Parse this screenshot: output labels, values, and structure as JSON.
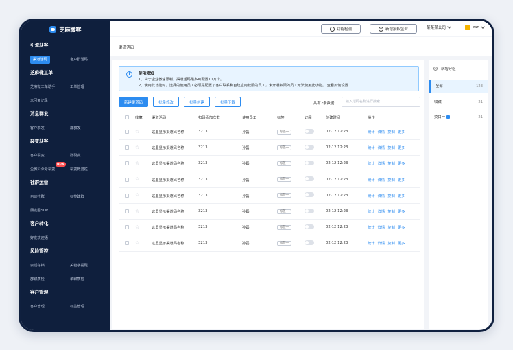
{
  "app": {
    "name": "芝麻微客"
  },
  "sidebar": {
    "sections": [
      {
        "title": "引流获客",
        "items": [
          "渠道活码",
          "客户群活码"
        ]
      },
      {
        "title": "芝麻微工单",
        "items": [
          "芝麻微工单助手",
          "工单管理",
          "未回复记录"
        ]
      },
      {
        "title": "消息群发",
        "items": [
          "客户群发",
          "群群发"
        ]
      },
      {
        "title": "裂变获客",
        "items": [
          "客户裂变",
          "群裂变",
          "企微公众号裂变",
          "裂变概览栏"
        ]
      },
      {
        "title": "社群运营",
        "items": [
          "自动拉群",
          "标签建群",
          "朋友圈SOP"
        ]
      },
      {
        "title": "客户转化",
        "items": [
          "好友欢迎语"
        ]
      },
      {
        "title": "风险管控",
        "items": [
          "会话存档",
          "关键字提醒",
          "群聊质检",
          "单聊质检"
        ]
      },
      {
        "title": "客户管理",
        "items": [
          "客户管理",
          "标签管理"
        ]
      }
    ],
    "new_badge": "NEW"
  },
  "topbar": {
    "btn_check": "功能检测",
    "btn_add_company": "新增授权企业",
    "company": "某某某公司",
    "user": "zan"
  },
  "breadcrumb": "渠道活码",
  "notice": {
    "title": "使用须知",
    "line1": "1、由于企业微信限制，渠道活码最多可配置10万个。",
    "line2": "2、使用此功能时，选择的使用员工必须是配置了客户联系和自建应用权限的员工，未开通权限的员工无法使用此功能。 查看如何设置"
  },
  "actions": {
    "new": "新建渠道码",
    "batch_edit": "批量修改",
    "batch_create": "批量创建",
    "batch_download": "批量下载",
    "total": "共有2条数据",
    "search_placeholder": "输入活码名称进行搜索"
  },
  "table": {
    "headers": [
      "收藏",
      "渠道活码",
      "扫码添加次数",
      "使用员工",
      "标签",
      "订阅",
      "创建时间",
      "操作"
    ],
    "rows": [
      {
        "name": "这里显示渠道码名称",
        "scans": "3213",
        "staff": "孙磊",
        "tag": "标签一",
        "time": "02-12 12:23"
      },
      {
        "name": "这里显示渠道码名称",
        "scans": "3213",
        "staff": "孙磊",
        "tag": "标签一",
        "time": "02-12 12:23"
      },
      {
        "name": "这里显示渠道码名称",
        "scans": "3213",
        "staff": "孙磊",
        "tag": "标签一",
        "time": "02-12 12:23"
      },
      {
        "name": "这里显示渠道码名称",
        "scans": "3213",
        "staff": "孙磊",
        "tag": "标签一",
        "time": "02-12 12:23"
      },
      {
        "name": "这里显示渠道码名称",
        "scans": "3213",
        "staff": "孙磊",
        "tag": "标签一",
        "time": "02-12 12:23"
      },
      {
        "name": "这里显示渠道码名称",
        "scans": "3213",
        "staff": "孙磊",
        "tag": "标签一",
        "time": "02-12 12:23"
      },
      {
        "name": "这里显示渠道码名称",
        "scans": "3213",
        "staff": "孙磊",
        "tag": "标签一",
        "time": "02-12 12:23"
      },
      {
        "name": "这里显示渠道码名称",
        "scans": "3213",
        "staff": "孙磊",
        "tag": "标签一",
        "time": "02-12 12:23"
      }
    ],
    "ops": [
      "统计",
      "详情",
      "复制",
      "更多"
    ]
  },
  "groups": {
    "add": "新增分组",
    "items": [
      {
        "label": "全部",
        "count": "123"
      },
      {
        "label": "收藏",
        "count": "21"
      },
      {
        "label": "类目一",
        "count": "21"
      }
    ]
  }
}
